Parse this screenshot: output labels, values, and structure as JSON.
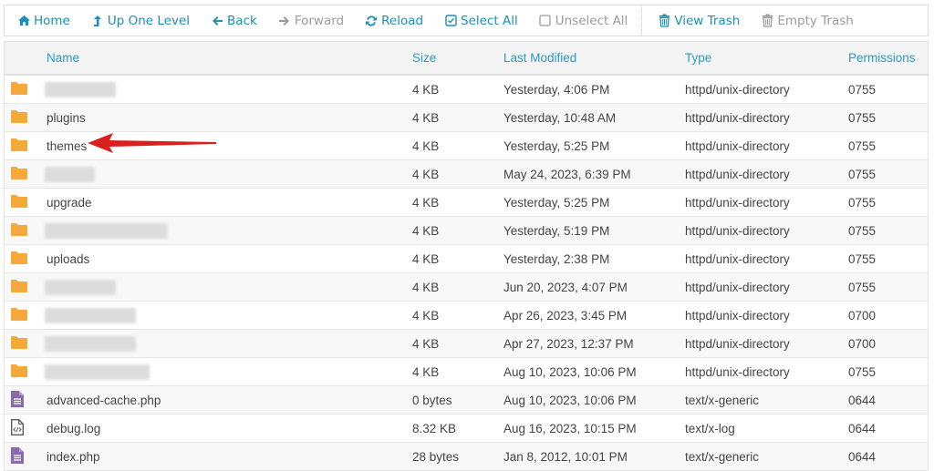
{
  "toolbar": {
    "buttons": [
      {
        "label": "Home",
        "icon": "home-icon",
        "state": "active"
      },
      {
        "label": "Up One Level",
        "icon": "level-up-icon",
        "state": "active"
      },
      {
        "label": "Back",
        "icon": "arrow-left-icon",
        "state": "active"
      },
      {
        "label": "Forward",
        "icon": "arrow-right-icon",
        "state": "disabled"
      },
      {
        "label": "Reload",
        "icon": "refresh-icon",
        "state": "active"
      },
      {
        "label": "Select All",
        "icon": "checkbox-checked-icon",
        "state": "active"
      },
      {
        "label": "Unselect All",
        "icon": "checkbox-empty-icon",
        "state": "disabled"
      },
      {
        "label": "View Trash",
        "icon": "trash-icon",
        "state": "active"
      },
      {
        "label": "Empty Trash",
        "icon": "trash-icon",
        "state": "disabled"
      }
    ]
  },
  "table": {
    "columns": [
      "Name",
      "Size",
      "Last Modified",
      "Type",
      "Permissions"
    ],
    "rows": [
      {
        "icon": "folder",
        "name": "",
        "redacted": true,
        "size": "4 KB",
        "modified": "Yesterday, 4:06 PM",
        "type": "httpd/unix-directory",
        "perms": "0755"
      },
      {
        "icon": "folder",
        "name": "plugins",
        "size": "4 KB",
        "modified": "Yesterday, 10:48 AM",
        "type": "httpd/unix-directory",
        "perms": "0755"
      },
      {
        "icon": "folder",
        "name": "themes",
        "size": "4 KB",
        "modified": "Yesterday, 5:25 PM",
        "type": "httpd/unix-directory",
        "perms": "0755"
      },
      {
        "icon": "folder",
        "name": "",
        "redacted": true,
        "size": "4 KB",
        "modified": "May 24, 2023, 6:39 PM",
        "type": "httpd/unix-directory",
        "perms": "0755"
      },
      {
        "icon": "folder",
        "name": "upgrade",
        "size": "4 KB",
        "modified": "Yesterday, 5:25 PM",
        "type": "httpd/unix-directory",
        "perms": "0755"
      },
      {
        "icon": "folder",
        "name": "",
        "redacted": true,
        "size": "4 KB",
        "modified": "Yesterday, 5:19 PM",
        "type": "httpd/unix-directory",
        "perms": "0755"
      },
      {
        "icon": "folder",
        "name": "uploads",
        "size": "4 KB",
        "modified": "Yesterday, 2:38 PM",
        "type": "httpd/unix-directory",
        "perms": "0755"
      },
      {
        "icon": "folder",
        "name": "",
        "redacted": true,
        "size": "4 KB",
        "modified": "Jun 20, 2023, 4:07 PM",
        "type": "httpd/unix-directory",
        "perms": "0755"
      },
      {
        "icon": "folder",
        "name": "",
        "redacted": true,
        "size": "4 KB",
        "modified": "Apr 26, 2023, 3:45 PM",
        "type": "httpd/unix-directory",
        "perms": "0700"
      },
      {
        "icon": "folder",
        "name": "",
        "redacted": true,
        "size": "4 KB",
        "modified": "Apr 27, 2023, 12:37 PM",
        "type": "httpd/unix-directory",
        "perms": "0700"
      },
      {
        "icon": "folder",
        "name": "",
        "redacted": true,
        "size": "4 KB",
        "modified": "Aug 10, 2023, 10:06 PM",
        "type": "httpd/unix-directory",
        "perms": "0755"
      },
      {
        "icon": "text-file",
        "name": "advanced-cache.php",
        "size": "0 bytes",
        "modified": "Aug 10, 2023, 10:06 PM",
        "type": "text/x-generic",
        "perms": "0644"
      },
      {
        "icon": "code-file",
        "name": "debug.log",
        "size": "8.32 KB",
        "modified": "Aug 16, 2023, 10:15 PM",
        "type": "text/x-log",
        "perms": "0644"
      },
      {
        "icon": "text-file",
        "name": "index.php",
        "size": "28 bytes",
        "modified": "Jan 8, 2012, 10:01 PM",
        "type": "text/x-generic",
        "perms": "0644"
      }
    ]
  },
  "annotation": {
    "type": "red-arrow",
    "points_to": "themes"
  },
  "colors": {
    "accent": "#1d8eb6",
    "header_text": "#2a9bc2",
    "disabled": "#9a9a9a",
    "folder": "#f5a93a",
    "file": "#8a6aa8",
    "arrow": "#d9201f"
  }
}
